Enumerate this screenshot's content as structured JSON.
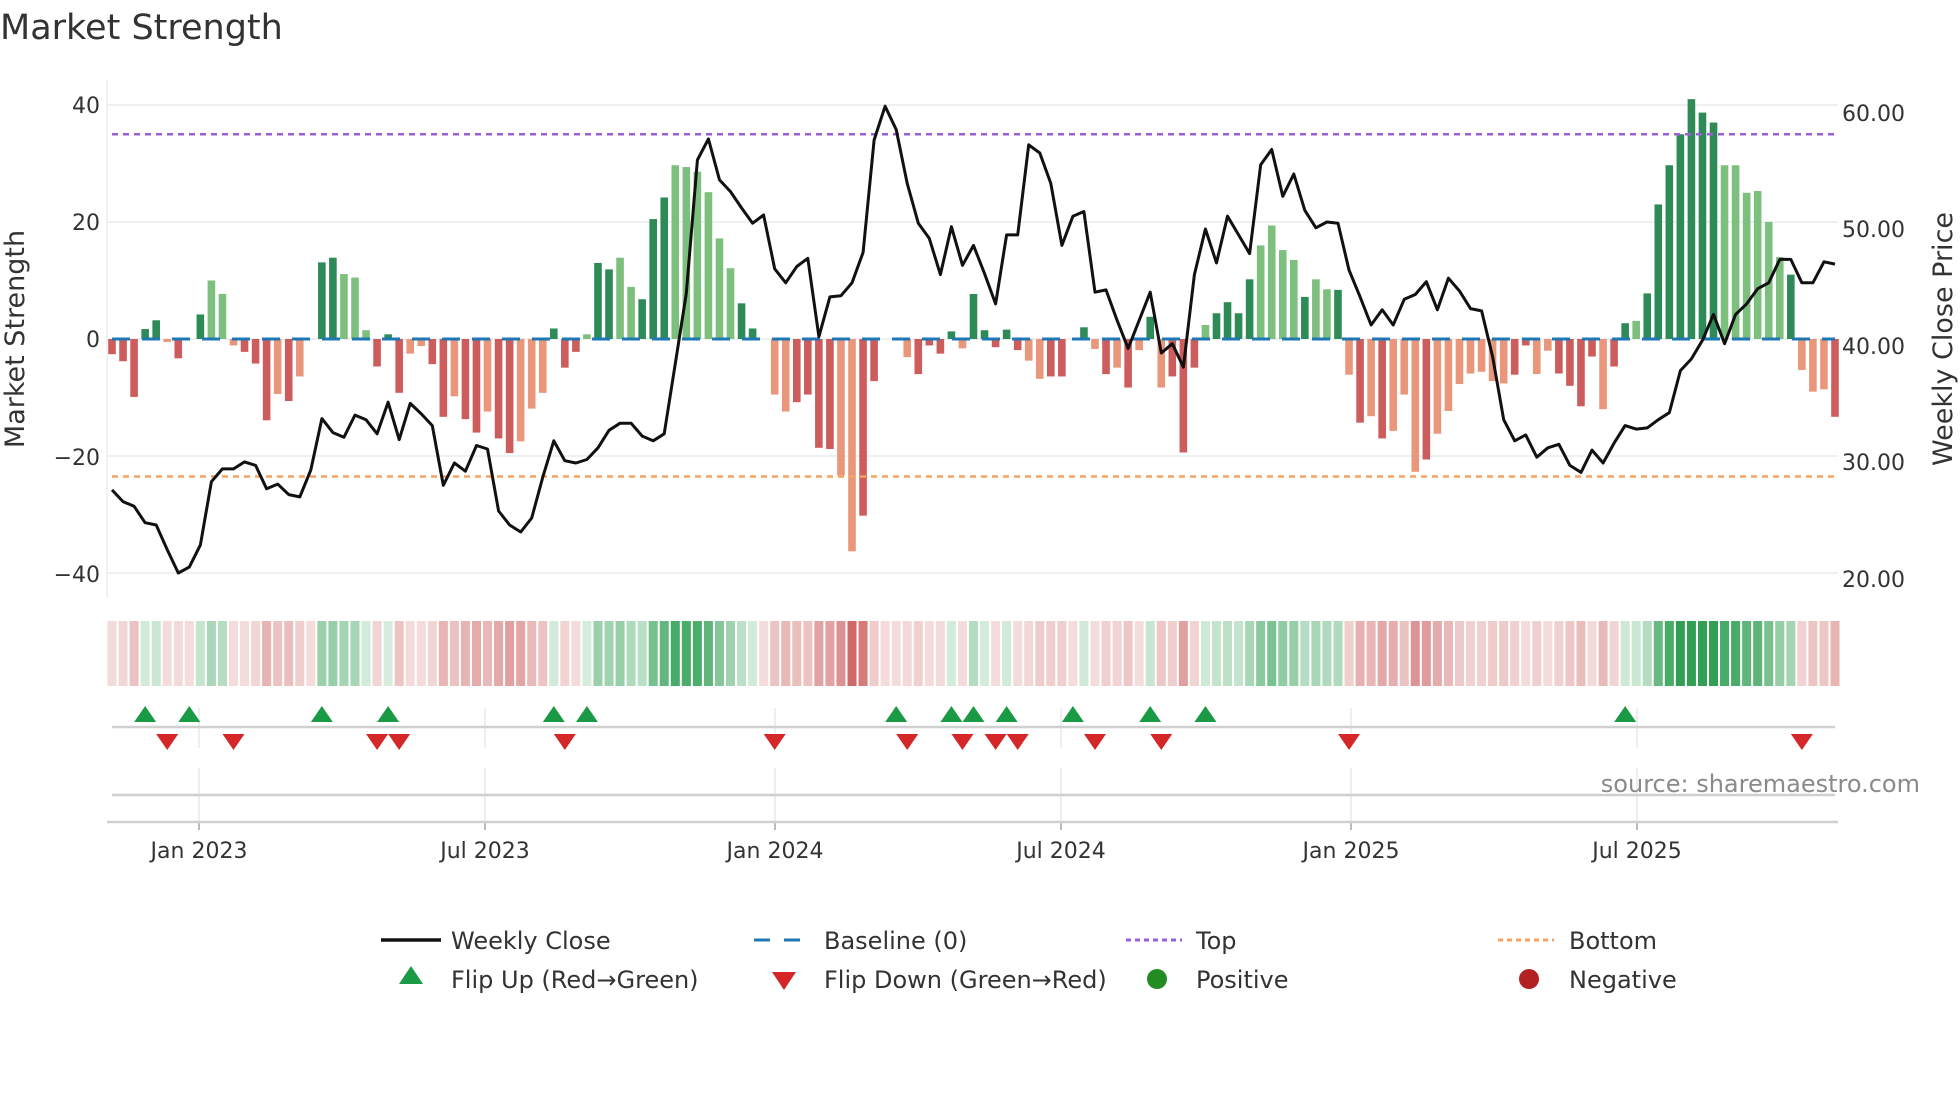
{
  "chart_data": {
    "type": "bar",
    "title": "Market Strength",
    "ylabel": "Market Strength",
    "y2label": "Weekly Close Price",
    "ylim": [
      -40,
      40
    ],
    "y2lim": [
      20,
      60
    ],
    "yticks": [
      "40",
      "20",
      "0",
      "−20",
      "−40"
    ],
    "y2ticks": [
      "60.00",
      "50.00",
      "40.00",
      "30.00",
      "20.00"
    ],
    "xticks": [
      "Jan 2023",
      "Jul 2023",
      "Jan 2024",
      "Jul 2024",
      "Jan 2025",
      "Jul 2025"
    ],
    "grid": true,
    "top_level": 35,
    "bottom_level": -23.5,
    "baseline": 0,
    "strength": [
      -2.6,
      -3.8,
      -9.9,
      1.7,
      3.2,
      -0.5,
      -3.3,
      0,
      4.2,
      10,
      7.7,
      -1.1,
      -2.2,
      -4.2,
      -13.9,
      -9.4,
      -10.6,
      -6.4,
      0,
      13.1,
      13.9,
      11.1,
      10.5,
      1.5,
      -4.7,
      0.8,
      -9.2,
      -2.5,
      -1.2,
      -4.3,
      -13.3,
      -9.8,
      -13.7,
      -16,
      -12.4,
      -17,
      -19.5,
      -17.5,
      -11.9,
      -9.2,
      1.8,
      -4.9,
      -2.2,
      0.8,
      13,
      11.9,
      13.9,
      8.9,
      6.8,
      20.5,
      24.2,
      29.7,
      29.4,
      28.6,
      25.1,
      17.2,
      12.1,
      6.1,
      1.8,
      0,
      -9.5,
      -12.4,
      -10.8,
      -9.5,
      -18.6,
      -18.8,
      -23.3,
      -36.3,
      -30.2,
      -7.2,
      0,
      0,
      -3.1,
      -6,
      -1.1,
      -2.5,
      1.3,
      -1.6,
      7.7,
      1.5,
      -1.4,
      1.6,
      -1.9,
      -3.7,
      -6.8,
      -6.4,
      -6.4,
      0,
      2,
      -1.7,
      -6,
      -4.9,
      -8.3,
      -1.9,
      3.8,
      -8.3,
      -6.4,
      -19.4,
      -4.9,
      2.4,
      4.4,
      6.3,
      4.4,
      10.2,
      16,
      19.4,
      15.2,
      13.5,
      7.2,
      10.2,
      8.5,
      8.4,
      -6.1,
      -14.3,
      -13.2,
      -17,
      -15.7,
      -9.5,
      -22.7,
      -20.6,
      -16.2,
      -12.3,
      -7.7,
      -5.9,
      -5.6,
      -7.2,
      -7.6,
      -6.1,
      -1.1,
      -6,
      -2,
      -5.9,
      -8,
      -11.5,
      -3,
      -12,
      -4.7,
      2.7,
      3.1,
      7.8,
      23,
      29.7,
      35,
      41,
      38.7,
      37,
      29.7,
      29.7,
      25,
      25.3,
      20,
      14,
      11,
      -5.3,
      -9,
      -8.6,
      -13.3
    ],
    "shade": "dddddldndllldddldlnddllldddllddlddlddllldddlddlldddllllllnddllddddllnnddlddddldddddllnddd ldldldldddlddddlllldlldldldllldlllllllddllddddlddldddddddlllllldllldddld",
    "weekly_close": [
      27.1,
      26.1,
      25.7,
      24.3,
      24.1,
      22.0,
      20.0,
      20.5,
      22.4,
      27.8,
      28.9,
      28.9,
      29.5,
      29.2,
      27.2,
      27.6,
      26.7,
      26.5,
      28.8,
      33.2,
      32.0,
      31.6,
      33.5,
      33.1,
      31.9,
      34.6,
      31.4,
      34.5,
      33.6,
      32.6,
      27.5,
      29.4,
      28.7,
      30.9,
      30.6,
      25.3,
      24.1,
      23.5,
      24.7,
      28.2,
      31.3,
      29.6,
      29.4,
      29.7,
      30.7,
      32.2,
      32.8,
      32.8,
      31.7,
      31.3,
      31.9,
      37.9,
      43.9,
      55.3,
      57.1,
      53.6,
      52.6,
      51.2,
      49.9,
      50.6,
      46.0,
      44.8,
      46.2,
      46.9,
      40.2,
      43.6,
      43.7,
      44.8,
      47.4,
      57.0,
      59.9,
      57.9,
      53.3,
      49.9,
      48.6,
      45.5,
      49.6,
      46.3,
      48.0,
      45.6,
      43.0,
      48.9,
      48.9,
      56.6,
      55.9,
      53.3,
      48.0,
      50.5,
      50.9,
      44.0,
      44.2,
      41.6,
      39.2,
      41.6,
      44.0,
      38.8,
      39.6,
      37.6,
      45.5,
      49.4,
      46.5,
      50.5,
      48.9,
      47.3,
      54.9,
      56.2,
      52.2,
      54.1,
      51.0,
      49.5,
      50.0,
      49.9,
      45.9,
      43.6,
      41.2,
      42.5,
      41.2,
      43.4,
      43.8,
      44.9,
      42.5,
      45.2,
      44.1,
      42.6,
      42.4,
      38.5,
      33.1,
      31.3,
      31.8,
      29.9,
      30.7,
      31.0,
      29.2,
      28.6,
      30.5,
      29.4,
      31.1,
      32.6,
      32.3,
      32.4,
      33.1,
      33.7,
      37.3,
      38.3,
      39.9,
      42.1,
      39.6,
      42.1,
      43.0,
      44.3,
      44.8,
      46.8,
      46.8,
      44.8,
      44.8,
      46.6,
      46.4
    ],
    "flip_up_weeks": [
      3,
      7,
      19,
      25,
      40,
      43,
      71,
      76,
      78,
      81,
      87,
      94,
      99,
      137
    ],
    "flip_down_weeks": [
      5,
      11,
      24,
      26,
      41,
      60,
      72,
      77,
      80,
      82,
      89,
      95,
      112,
      153
    ],
    "legend": {
      "position": "bottom",
      "items": [
        "Weekly Close",
        "Baseline (0)",
        "Top",
        "Bottom",
        "Flip Up (Red→Green)",
        "Flip Down (Green→Red)",
        "Positive",
        "Negative"
      ]
    },
    "source": "source: sharemaestro.com"
  },
  "colors": {
    "pos_dark": "#2e8b57",
    "pos_light": "#7dbf7d",
    "neg_dark": "#cd5c5c",
    "neg_light": "#e9967a",
    "baseline": "#1f77b4",
    "top": "#9b5fd6",
    "bottom": "#f4a460",
    "line": "#111111",
    "flip_up": "#1a9a44",
    "flip_down": "#d62728",
    "positive": "#228b22",
    "negative": "#b22222"
  }
}
